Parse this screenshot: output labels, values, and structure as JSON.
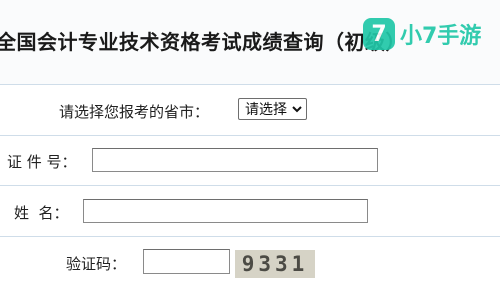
{
  "header": {
    "title": "全国会计专业技术资格考试成绩查询（初级）"
  },
  "watermark": {
    "badge": "7",
    "text": "小7手游"
  },
  "form": {
    "province": {
      "label": "请选择您报考的省市：",
      "selected": "请选择"
    },
    "id_number": {
      "label": "证 件 号：",
      "value": ""
    },
    "name": {
      "label": "姓  名：",
      "value": ""
    },
    "captcha": {
      "label": "验证码：",
      "value": "",
      "image_text": "9331"
    }
  }
}
